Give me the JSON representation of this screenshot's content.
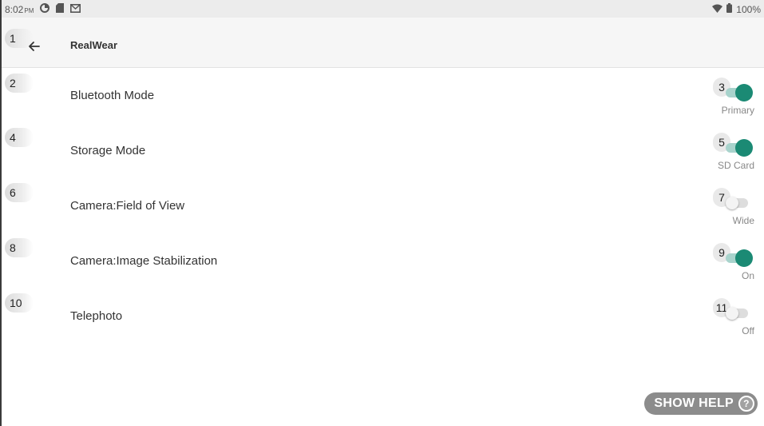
{
  "status_bar": {
    "time": "8:02",
    "meridiem": "PM",
    "left_icons": [
      "sync-icon",
      "sd-card-icon",
      "mail-icon"
    ],
    "battery": "100%",
    "right_icons": [
      "wifi-icon",
      "battery-icon"
    ]
  },
  "app_bar": {
    "title": "RealWear",
    "back_badge": "1"
  },
  "settings": [
    {
      "badge": "2",
      "label": "Bluetooth Mode",
      "switch_badge": "3",
      "value": "Primary",
      "on": true
    },
    {
      "badge": "4",
      "label": "Storage Mode",
      "switch_badge": "5",
      "value": "SD Card",
      "on": true
    },
    {
      "badge": "6",
      "label": "Camera:Field of View",
      "switch_badge": "7",
      "value": "Wide",
      "on": false
    },
    {
      "badge": "8",
      "label": "Camera:Image Stabilization",
      "switch_badge": "9",
      "value": "On",
      "on": true
    },
    {
      "badge": "10",
      "label": "Telephoto",
      "switch_badge": "11",
      "value": "Off",
      "on": false
    }
  ],
  "help": {
    "label": "SHOW HELP",
    "icon": "?"
  },
  "colors": {
    "accent": "#1b8a74",
    "accent_track": "#a8d3cc",
    "off_track": "#dddddd",
    "help_pill": "#8c8c8c"
  }
}
